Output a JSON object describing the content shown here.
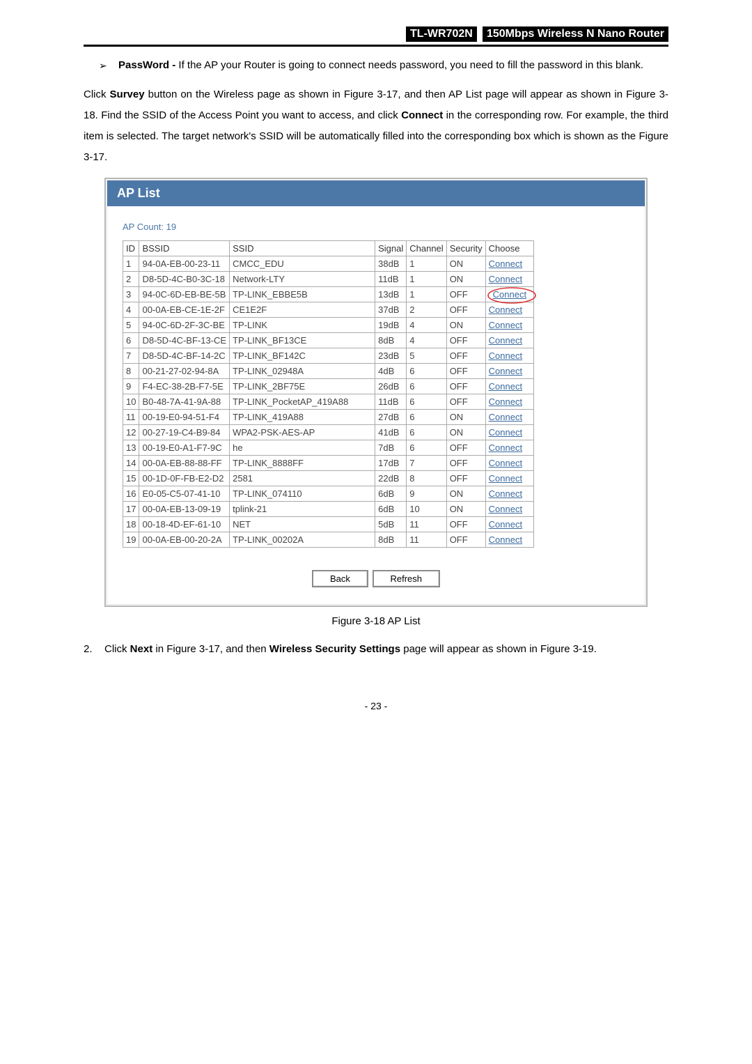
{
  "header": {
    "model": "TL-WR702N",
    "desc": "150Mbps  Wireless  N  Nano  Router"
  },
  "bullet": {
    "label": "PassWord - ",
    "text": "If the AP your Router is going to connect needs password, you need to fill the password in this blank."
  },
  "para1_a": "Click ",
  "para1_survey": "Survey",
  "para1_b": " button on the Wireless page as shown in Figure 3-17, and then AP List page will appear as shown in Figure 3-18. Find the SSID of the Access Point you want to access, and click ",
  "para1_connect": "Connect",
  "para1_c": " in the corresponding row. For example, the third item is selected. The target network's SSID will be automatically filled into the corresponding box which is shown as the Figure 3-17.",
  "figure": {
    "title": "AP List",
    "count_label": "AP Count:   19",
    "cols": {
      "id": "ID",
      "bssid": "BSSID",
      "ssid": "SSID",
      "signal": "Signal",
      "channel": "Channel",
      "security": "Security",
      "choose": "Choose"
    },
    "rows": [
      {
        "id": "1",
        "bssid": "94-0A-EB-00-23-11",
        "ssid": "CMCC_EDU",
        "signal": "38dB",
        "channel": "1",
        "security": "ON",
        "choose": "Connect"
      },
      {
        "id": "2",
        "bssid": "D8-5D-4C-B0-3C-18",
        "ssid": "Network-LTY",
        "signal": "11dB",
        "channel": "1",
        "security": "ON",
        "choose": "Connect"
      },
      {
        "id": "3",
        "bssid": "94-0C-6D-EB-BE-5B",
        "ssid": "TP-LINK_EBBE5B",
        "signal": "13dB",
        "channel": "1",
        "security": "OFF",
        "choose": "Connect",
        "circled": true
      },
      {
        "id": "4",
        "bssid": "00-0A-EB-CE-1E-2F",
        "ssid": "CE1E2F",
        "signal": "37dB",
        "channel": "2",
        "security": "OFF",
        "choose": "Connect"
      },
      {
        "id": "5",
        "bssid": "94-0C-6D-2F-3C-BE",
        "ssid": "TP-LINK",
        "signal": "19dB",
        "channel": "4",
        "security": "ON",
        "choose": "Connect"
      },
      {
        "id": "6",
        "bssid": "D8-5D-4C-BF-13-CE",
        "ssid": "TP-LINK_BF13CE",
        "signal": "8dB",
        "channel": "4",
        "security": "OFF",
        "choose": "Connect"
      },
      {
        "id": "7",
        "bssid": "D8-5D-4C-BF-14-2C",
        "ssid": "TP-LINK_BF142C",
        "signal": "23dB",
        "channel": "5",
        "security": "OFF",
        "choose": "Connect"
      },
      {
        "id": "8",
        "bssid": "00-21-27-02-94-8A",
        "ssid": "TP-LINK_02948A",
        "signal": "4dB",
        "channel": "6",
        "security": "OFF",
        "choose": "Connect"
      },
      {
        "id": "9",
        "bssid": "F4-EC-38-2B-F7-5E",
        "ssid": "TP-LINK_2BF75E",
        "signal": "26dB",
        "channel": "6",
        "security": "OFF",
        "choose": "Connect"
      },
      {
        "id": "10",
        "bssid": "B0-48-7A-41-9A-88",
        "ssid": "TP-LINK_PocketAP_419A88",
        "signal": "11dB",
        "channel": "6",
        "security": "OFF",
        "choose": "Connect"
      },
      {
        "id": "11",
        "bssid": "00-19-E0-94-51-F4",
        "ssid": "TP-LINK_419A88",
        "signal": "27dB",
        "channel": "6",
        "security": "ON",
        "choose": "Connect"
      },
      {
        "id": "12",
        "bssid": "00-27-19-C4-B9-84",
        "ssid": "WPA2-PSK-AES-AP",
        "signal": "41dB",
        "channel": "6",
        "security": "ON",
        "choose": "Connect"
      },
      {
        "id": "13",
        "bssid": "00-19-E0-A1-F7-9C",
        "ssid": "he",
        "signal": "7dB",
        "channel": "6",
        "security": "OFF",
        "choose": "Connect"
      },
      {
        "id": "14",
        "bssid": "00-0A-EB-88-88-FF",
        "ssid": "TP-LINK_8888FF",
        "signal": "17dB",
        "channel": "7",
        "security": "OFF",
        "choose": "Connect"
      },
      {
        "id": "15",
        "bssid": "00-1D-0F-FB-E2-D2",
        "ssid": "2581",
        "signal": "22dB",
        "channel": "8",
        "security": "OFF",
        "choose": "Connect"
      },
      {
        "id": "16",
        "bssid": "E0-05-C5-07-41-10",
        "ssid": "TP-LINK_074110",
        "signal": "6dB",
        "channel": "9",
        "security": "ON",
        "choose": "Connect"
      },
      {
        "id": "17",
        "bssid": "00-0A-EB-13-09-19",
        "ssid": "tplink-21",
        "signal": "6dB",
        "channel": "10",
        "security": "ON",
        "choose": "Connect"
      },
      {
        "id": "18",
        "bssid": "00-18-4D-EF-61-10",
        "ssid": "NET",
        "signal": "5dB",
        "channel": "11",
        "security": "OFF",
        "choose": "Connect"
      },
      {
        "id": "19",
        "bssid": "00-0A-EB-00-20-2A",
        "ssid": "TP-LINK_00202A",
        "signal": "8dB",
        "channel": "11",
        "security": "OFF",
        "choose": "Connect"
      }
    ],
    "back": "Back",
    "refresh": "Refresh"
  },
  "caption": "Figure 3-18 AP List",
  "step2_num": "2.",
  "step2_a": "Click ",
  "step2_next": "Next",
  "step2_b": " in Figure 3-17, and then ",
  "step2_wss": "Wireless Security Settings",
  "step2_c": " page will appear as shown in Figure 3-19.",
  "footer": "- 23 -"
}
